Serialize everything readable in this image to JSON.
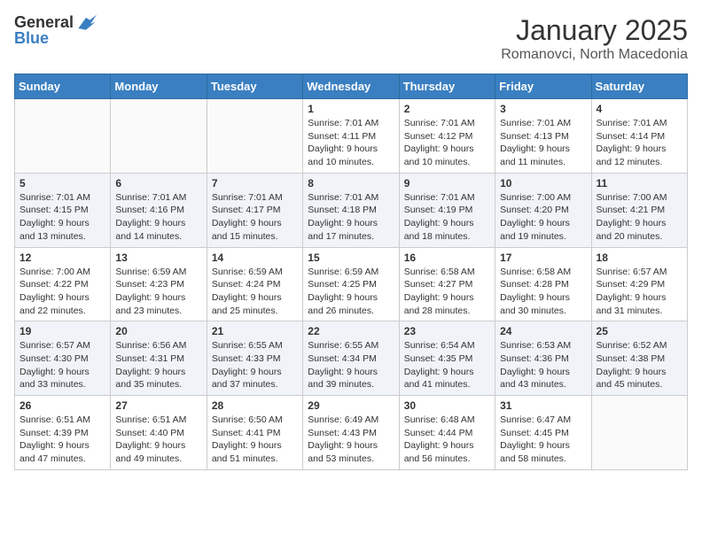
{
  "logo": {
    "general": "General",
    "blue": "Blue"
  },
  "header": {
    "month": "January 2025",
    "location": "Romanovci, North Macedonia"
  },
  "weekdays": [
    "Sunday",
    "Monday",
    "Tuesday",
    "Wednesday",
    "Thursday",
    "Friday",
    "Saturday"
  ],
  "weeks": [
    [
      {
        "day": "",
        "info": ""
      },
      {
        "day": "",
        "info": ""
      },
      {
        "day": "",
        "info": ""
      },
      {
        "day": "1",
        "info": "Sunrise: 7:01 AM\nSunset: 4:11 PM\nDaylight: 9 hours\nand 10 minutes."
      },
      {
        "day": "2",
        "info": "Sunrise: 7:01 AM\nSunset: 4:12 PM\nDaylight: 9 hours\nand 10 minutes."
      },
      {
        "day": "3",
        "info": "Sunrise: 7:01 AM\nSunset: 4:13 PM\nDaylight: 9 hours\nand 11 minutes."
      },
      {
        "day": "4",
        "info": "Sunrise: 7:01 AM\nSunset: 4:14 PM\nDaylight: 9 hours\nand 12 minutes."
      }
    ],
    [
      {
        "day": "5",
        "info": "Sunrise: 7:01 AM\nSunset: 4:15 PM\nDaylight: 9 hours\nand 13 minutes."
      },
      {
        "day": "6",
        "info": "Sunrise: 7:01 AM\nSunset: 4:16 PM\nDaylight: 9 hours\nand 14 minutes."
      },
      {
        "day": "7",
        "info": "Sunrise: 7:01 AM\nSunset: 4:17 PM\nDaylight: 9 hours\nand 15 minutes."
      },
      {
        "day": "8",
        "info": "Sunrise: 7:01 AM\nSunset: 4:18 PM\nDaylight: 9 hours\nand 17 minutes."
      },
      {
        "day": "9",
        "info": "Sunrise: 7:01 AM\nSunset: 4:19 PM\nDaylight: 9 hours\nand 18 minutes."
      },
      {
        "day": "10",
        "info": "Sunrise: 7:00 AM\nSunset: 4:20 PM\nDaylight: 9 hours\nand 19 minutes."
      },
      {
        "day": "11",
        "info": "Sunrise: 7:00 AM\nSunset: 4:21 PM\nDaylight: 9 hours\nand 20 minutes."
      }
    ],
    [
      {
        "day": "12",
        "info": "Sunrise: 7:00 AM\nSunset: 4:22 PM\nDaylight: 9 hours\nand 22 minutes."
      },
      {
        "day": "13",
        "info": "Sunrise: 6:59 AM\nSunset: 4:23 PM\nDaylight: 9 hours\nand 23 minutes."
      },
      {
        "day": "14",
        "info": "Sunrise: 6:59 AM\nSunset: 4:24 PM\nDaylight: 9 hours\nand 25 minutes."
      },
      {
        "day": "15",
        "info": "Sunrise: 6:59 AM\nSunset: 4:25 PM\nDaylight: 9 hours\nand 26 minutes."
      },
      {
        "day": "16",
        "info": "Sunrise: 6:58 AM\nSunset: 4:27 PM\nDaylight: 9 hours\nand 28 minutes."
      },
      {
        "day": "17",
        "info": "Sunrise: 6:58 AM\nSunset: 4:28 PM\nDaylight: 9 hours\nand 30 minutes."
      },
      {
        "day": "18",
        "info": "Sunrise: 6:57 AM\nSunset: 4:29 PM\nDaylight: 9 hours\nand 31 minutes."
      }
    ],
    [
      {
        "day": "19",
        "info": "Sunrise: 6:57 AM\nSunset: 4:30 PM\nDaylight: 9 hours\nand 33 minutes."
      },
      {
        "day": "20",
        "info": "Sunrise: 6:56 AM\nSunset: 4:31 PM\nDaylight: 9 hours\nand 35 minutes."
      },
      {
        "day": "21",
        "info": "Sunrise: 6:55 AM\nSunset: 4:33 PM\nDaylight: 9 hours\nand 37 minutes."
      },
      {
        "day": "22",
        "info": "Sunrise: 6:55 AM\nSunset: 4:34 PM\nDaylight: 9 hours\nand 39 minutes."
      },
      {
        "day": "23",
        "info": "Sunrise: 6:54 AM\nSunset: 4:35 PM\nDaylight: 9 hours\nand 41 minutes."
      },
      {
        "day": "24",
        "info": "Sunrise: 6:53 AM\nSunset: 4:36 PM\nDaylight: 9 hours\nand 43 minutes."
      },
      {
        "day": "25",
        "info": "Sunrise: 6:52 AM\nSunset: 4:38 PM\nDaylight: 9 hours\nand 45 minutes."
      }
    ],
    [
      {
        "day": "26",
        "info": "Sunrise: 6:51 AM\nSunset: 4:39 PM\nDaylight: 9 hours\nand 47 minutes."
      },
      {
        "day": "27",
        "info": "Sunrise: 6:51 AM\nSunset: 4:40 PM\nDaylight: 9 hours\nand 49 minutes."
      },
      {
        "day": "28",
        "info": "Sunrise: 6:50 AM\nSunset: 4:41 PM\nDaylight: 9 hours\nand 51 minutes."
      },
      {
        "day": "29",
        "info": "Sunrise: 6:49 AM\nSunset: 4:43 PM\nDaylight: 9 hours\nand 53 minutes."
      },
      {
        "day": "30",
        "info": "Sunrise: 6:48 AM\nSunset: 4:44 PM\nDaylight: 9 hours\nand 56 minutes."
      },
      {
        "day": "31",
        "info": "Sunrise: 6:47 AM\nSunset: 4:45 PM\nDaylight: 9 hours\nand 58 minutes."
      },
      {
        "day": "",
        "info": ""
      }
    ]
  ]
}
